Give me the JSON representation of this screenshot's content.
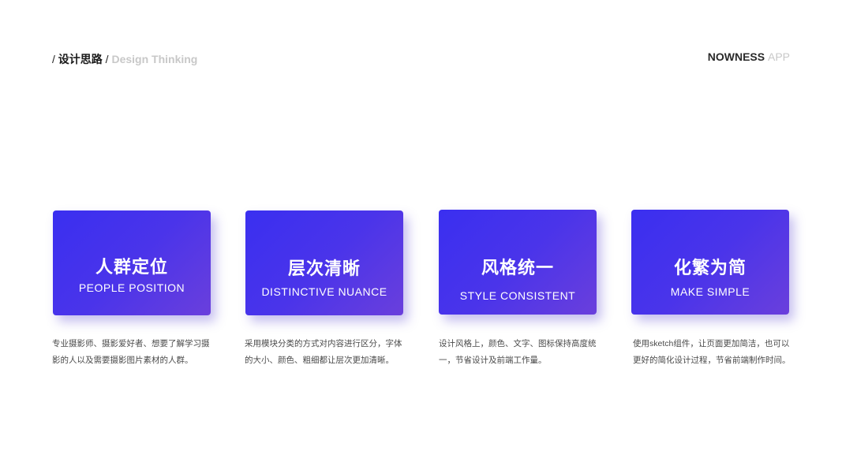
{
  "header": {
    "slash": "/",
    "section_cn": "设计思路",
    "section_en": "Design Thinking",
    "brand_main": "NOWNESS",
    "brand_sub": "APP"
  },
  "cards": [
    {
      "title_cn": "人群定位",
      "title_en": "PEOPLE POSITION",
      "description": "专业摄影师、摄影爱好者、想要了解学习摄影的人以及需要摄影图片素材的人群。"
    },
    {
      "title_cn": "层次清晰",
      "title_en": "DISTINCTIVE NUANCE",
      "description": "采用模块分类的方式对内容进行区分，字体的大小、颜色、粗细都让层次更加清晰。"
    },
    {
      "title_cn": "风格统一",
      "title_en": "STYLE CONSISTENT",
      "description": "设计风格上，颜色、文字、图标保持高度统一，节省设计及前端工作量。"
    },
    {
      "title_cn": "化繁为简",
      "title_en": "MAKE SIMPLE",
      "description": "使用sketch组件，让页面更加简洁，也可以更好的简化设计过程，节省前端制作时间。"
    }
  ],
  "colors": {
    "card_gradient_start": "#3a2ff0",
    "card_gradient_end": "#6a3fdc",
    "text_dark": "#1b1b1b",
    "text_light": "#c8c8c8"
  }
}
